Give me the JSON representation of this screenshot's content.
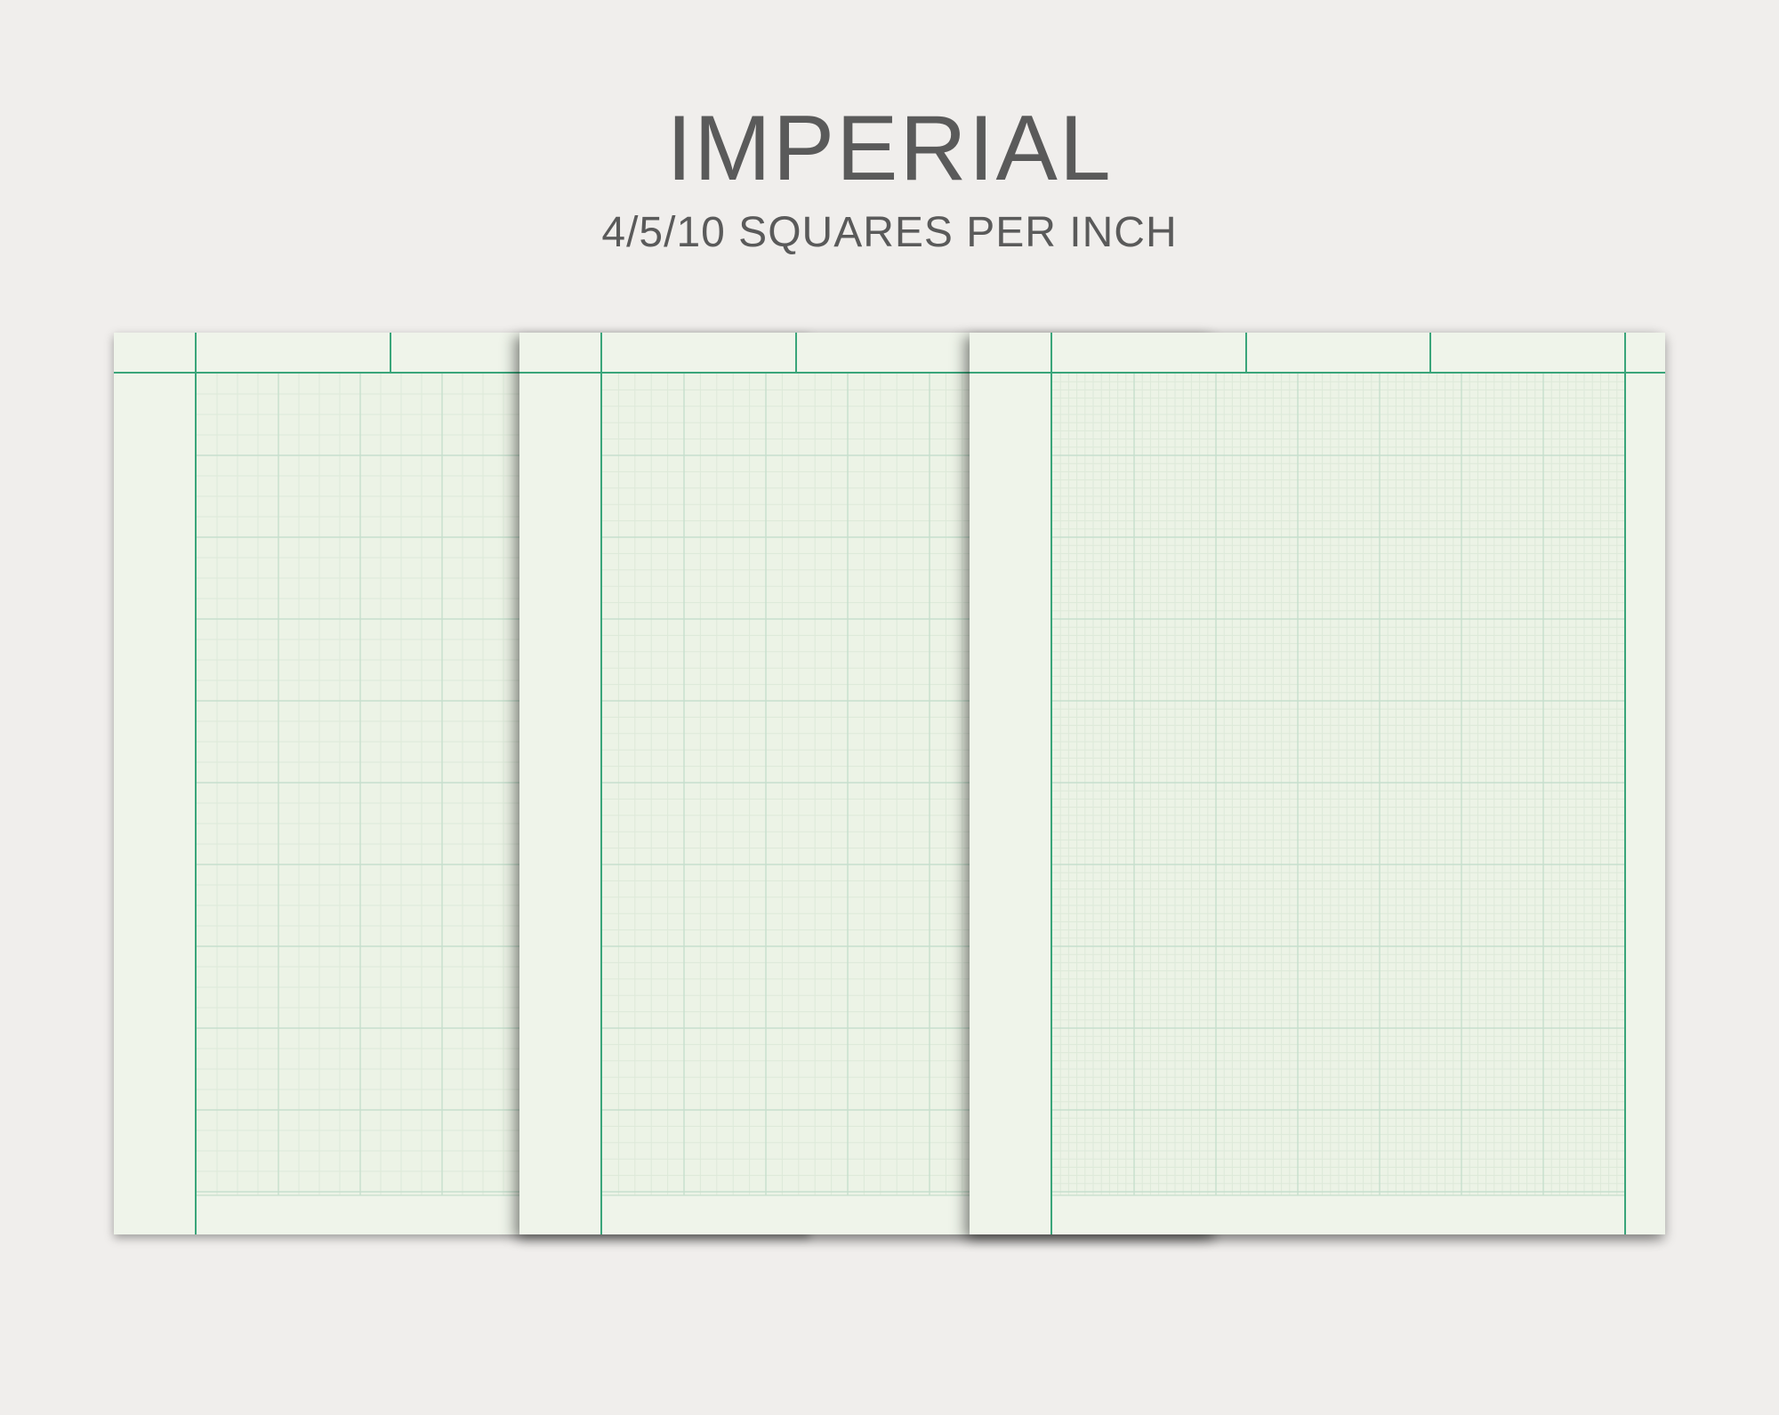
{
  "header": {
    "title": "IMPERIAL",
    "subtitle": "4/5/10 SQUARES PER INCH"
  },
  "colors": {
    "background": "#f0eeec",
    "paper": "#eff4ea",
    "grid_area": "#ecf3e6",
    "border_line": "#3aa57a",
    "grid_major": "#c6dfcd",
    "grid_minor": "#dde9d9",
    "text": "#5a5a5a"
  },
  "sheets": [
    {
      "name": "sheet-4-per-inch",
      "squares_per_inch": 4,
      "margin_column": "left",
      "header_columns": 2
    },
    {
      "name": "sheet-5-per-inch",
      "squares_per_inch": 5,
      "margin_column": "left",
      "header_columns": 2
    },
    {
      "name": "sheet-10-per-inch",
      "squares_per_inch": 10,
      "margin_column": "left-and-right",
      "header_columns": 3
    }
  ]
}
